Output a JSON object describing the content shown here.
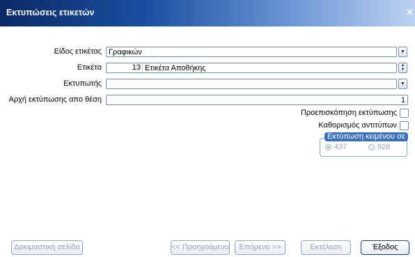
{
  "window": {
    "title": "Εκτυπώσεις ετικετών",
    "close_label": "×"
  },
  "form": {
    "label_type": {
      "label": "Είδος ετικέτας",
      "value": "Γραφικών"
    },
    "label": {
      "label": "Ετικέτα",
      "number": "13",
      "value": "Ετικέτα Αποθήκης"
    },
    "printer": {
      "label": "Εκτυπωτής",
      "value": ""
    },
    "start_position": {
      "label": "Αρχή εκτύπωσης απο θέση",
      "value": "1"
    },
    "print_preview": {
      "label": "Προεπισκόπηση εκτύπωσης",
      "checked": false
    },
    "copies_setting": {
      "label": "Καθορισμός αντιτύπων",
      "checked": false
    }
  },
  "text_print_group": {
    "title": "Εκτύπωση κειμένου σε",
    "options": [
      {
        "label": "437",
        "selected": true
      },
      {
        "label": "928",
        "selected": false
      }
    ]
  },
  "buttons": {
    "test_page": "Δοκιμαστική σελίδα",
    "previous": "<< Προηγούμενο",
    "next": "Επόμενο >>",
    "execute": "Εκτέλεση",
    "exit": "Έξοδος"
  },
  "colors": {
    "titlebar_dark": "#0a2a66",
    "group_title_bg": "#3b6fbf",
    "disabled_text": "#9aa3b3"
  }
}
